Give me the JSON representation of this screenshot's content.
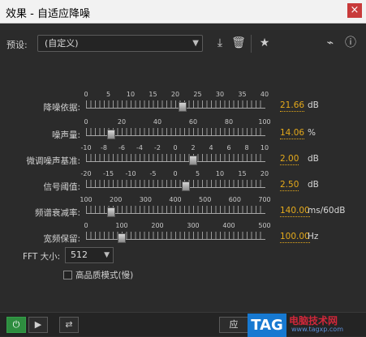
{
  "window": {
    "title": "效果 - 自适应降噪",
    "close_symbol": "×"
  },
  "toolbar": {
    "preset_label": "预设:",
    "preset_value": "(自定义)",
    "icons": [
      "save-preset-icon",
      "delete-preset-icon",
      "favorite-star-icon",
      "routing-icon",
      "info-icon"
    ]
  },
  "rows": [
    {
      "label": "降噪依据:",
      "ticks": [
        "0",
        "5",
        "10",
        "15",
        "20",
        "25",
        "30",
        "35",
        "40"
      ],
      "value": "21.66",
      "unit": "dB",
      "level_percent": 54
    },
    {
      "label": "噪声量:",
      "ticks": [
        "0",
        "20",
        "40",
        "60",
        "80",
        "100"
      ],
      "value": "14.06",
      "unit": "%",
      "level_percent": 14
    },
    {
      "label": "微调噪声基准:",
      "ticks": [
        "-10",
        "-8",
        "-6",
        "-4",
        "-2",
        "0",
        "2",
        "4",
        "6",
        "8",
        "10"
      ],
      "value": "2.00",
      "unit": "dB",
      "level_percent": 60
    },
    {
      "label": "信号阈值:",
      "ticks": [
        "-20",
        "-15",
        "-10",
        "-5",
        "0",
        "5",
        "10",
        "15",
        "20"
      ],
      "value": "2.50",
      "unit": "dB",
      "level_percent": 56
    },
    {
      "label": "频谱衰减率:",
      "ticks": [
        "100",
        "200",
        "300",
        "400",
        "500",
        "600",
        "700"
      ],
      "value": "140.00",
      "unit": "ms/60dB",
      "level_percent": 14
    },
    {
      "label": "宽频保留:",
      "ticks": [
        "0",
        "100",
        "200",
        "300",
        "400",
        "500"
      ],
      "value": "100.00",
      "unit": "Hz",
      "level_percent": 20
    }
  ],
  "fft": {
    "label": "FFT 大小:",
    "value": "512"
  },
  "high_quality": {
    "label": "高品质模式(慢)",
    "checked": false
  },
  "footer": {
    "apply_label": "应",
    "watermark_tag": "TAG",
    "watermark_title": "电脑技术网",
    "watermark_url": "www.tagxp.com"
  }
}
